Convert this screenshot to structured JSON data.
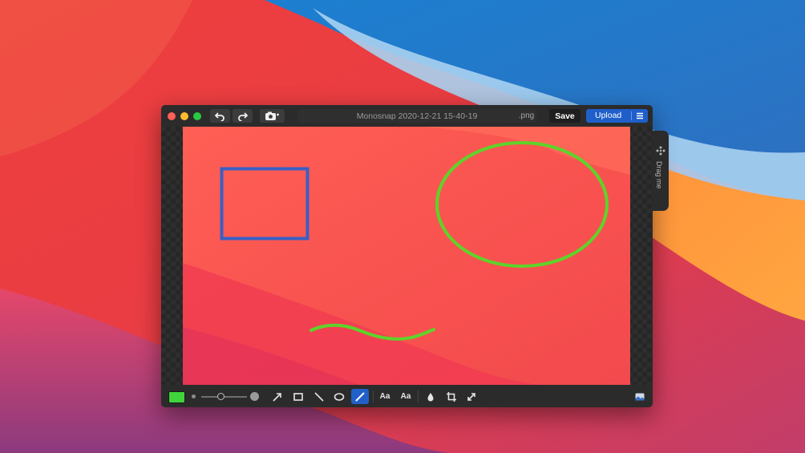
{
  "window": {
    "filename": "Monosnap 2020-12-21 15-40-19",
    "extension": ".png",
    "save_label": "Save",
    "upload_label": "Upload"
  },
  "drag_handle": {
    "label": "Drag me"
  },
  "toolbar": {
    "current_color": "#3ed43a",
    "active_tool": "pen",
    "tools": [
      {
        "name": "arrow",
        "icon": "arrow-icon"
      },
      {
        "name": "rectangle",
        "icon": "rectangle-icon"
      },
      {
        "name": "line",
        "icon": "line-icon"
      },
      {
        "name": "ellipse",
        "icon": "ellipse-icon"
      },
      {
        "name": "pen",
        "icon": "pen-icon"
      },
      {
        "name": "text",
        "icon": "text-icon",
        "label": "Aa"
      },
      {
        "name": "text-callout",
        "icon": "text-callout-icon",
        "label": "Aa"
      },
      {
        "name": "blur",
        "icon": "blur-icon"
      },
      {
        "name": "crop",
        "icon": "crop-icon"
      },
      {
        "name": "resize",
        "icon": "resize-icon"
      }
    ]
  },
  "annotations": {
    "rectangle_color": "#3a5fc4",
    "ellipse_color": "#5fd32a",
    "pen_stroke_color": "#5fd32a"
  }
}
